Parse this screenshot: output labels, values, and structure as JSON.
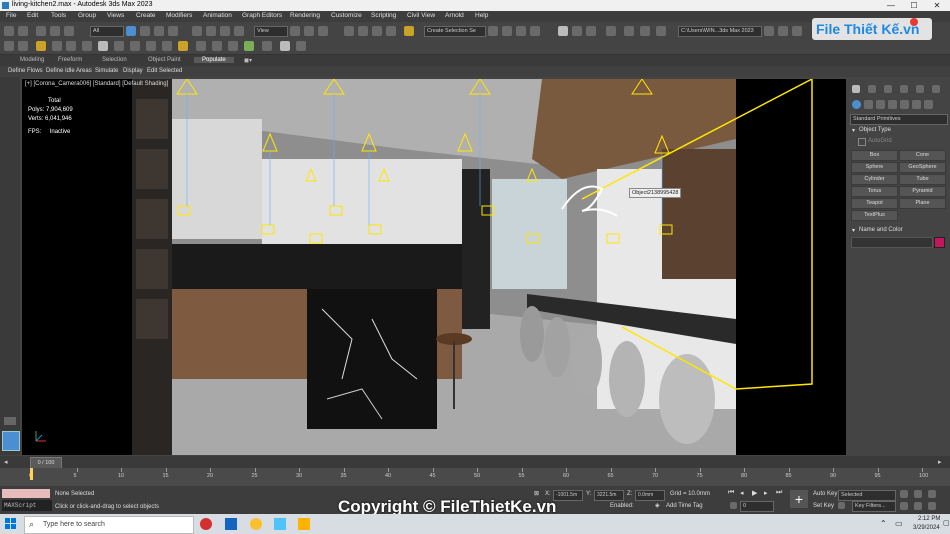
{
  "window": {
    "title": "living-kitchen2.max - Autodesk 3ds Max 2023",
    "minimize": "—",
    "maximize": "☐",
    "close": "✕"
  },
  "menu": [
    "File",
    "Edit",
    "Tools",
    "Group",
    "Views",
    "Create",
    "Modifiers",
    "Animation",
    "Graph Editors",
    "Rendering",
    "Customize",
    "Scripting",
    "Civil View",
    "Arnold",
    "Help"
  ],
  "toolbar": {
    "filter": "All",
    "view": "View",
    "selection_set": "Create Selection Se",
    "workspace_path": "C:\\Users\\WIN...3ds Max 2023"
  },
  "ribbon": {
    "tabs": [
      "Modeling",
      "Freeform",
      "Selection",
      "Object Paint",
      "Populate"
    ],
    "active": "Populate"
  },
  "subbar": [
    "Define Flows",
    "Define Idle Areas",
    "Simulate",
    "Display",
    "Edit Selected"
  ],
  "viewport": {
    "label": "[+] [Corona_Camera006] [Standard] [Default Shading]",
    "stats_header": "Total",
    "polys_label": "Polys:",
    "polys_value": "7,904,609",
    "verts_label": "Verts:",
    "verts_value": "6,041,946",
    "fps_label": "FPS:",
    "fps_value": "Inactive",
    "tooltip": "Object2138995428"
  },
  "command_panel": {
    "dropdown": "Standard Primitives",
    "object_type_title": "Object Type",
    "autogrid": "AutoGrid",
    "buttons": [
      "Box",
      "Cone",
      "Sphere",
      "GeoSphere",
      "Cylinder",
      "Tube",
      "Torus",
      "Pyramid",
      "Teapot",
      "Plane",
      "TextPlus"
    ],
    "name_color_title": "Name and Color",
    "color": "#c2185b"
  },
  "timeline": {
    "frame": "0 / 100",
    "ticks": [
      "0",
      "5",
      "10",
      "15",
      "20",
      "25",
      "30",
      "35",
      "40",
      "45",
      "50",
      "55",
      "60",
      "65",
      "70",
      "75",
      "80",
      "85",
      "90",
      "95",
      "100"
    ]
  },
  "status": {
    "maxscript": "MAXScript",
    "selection": "None Selected",
    "prompt": "Click or click-and-drag to select objects",
    "x_label": "X:",
    "x_value": "-1001.5m",
    "y_label": "Y:",
    "y_value": "3221.5m",
    "z_label": "Z:",
    "z_value": "0.0mm",
    "grid": "Grid = 10.0mm",
    "enabled": "Enabled:",
    "add_time_tag": "Add Time Tag",
    "auto_key": "Auto Key",
    "set_key": "Set Key",
    "key_mode": "Selected",
    "key_filters": "Key Filters...",
    "frame_input": "0"
  },
  "watermark": "Copyright © FileThietKe.vn",
  "logo_text": "File Thiết Kế.vn",
  "taskbar": {
    "search_placeholder": "Type here to search",
    "time": "2:12 PM",
    "date": "3/29/2024"
  },
  "colors": {
    "accent": "#4c8fd0",
    "selection_yellow": "#ffe600",
    "logo_blue": "#1e88e5"
  }
}
